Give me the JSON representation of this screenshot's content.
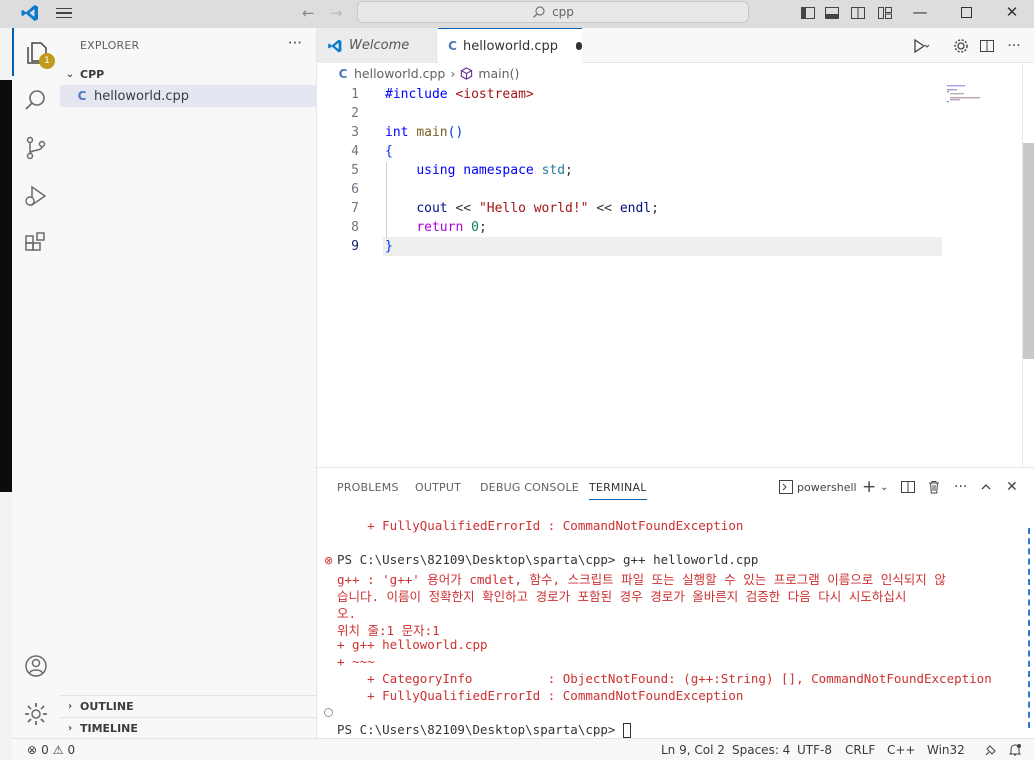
{
  "titlebar": {
    "search_text": "cpp",
    "back_arrow": "←",
    "forward_arrow": "→"
  },
  "activity": {
    "explorer_badge": "1"
  },
  "sidebar": {
    "title": "EXPLORER",
    "more": "···",
    "folder": "CPP",
    "file": "helloworld.cpp",
    "outline": "OUTLINE",
    "timeline": "TIMELINE"
  },
  "tabs": {
    "welcome": "Welcome",
    "active": "helloworld.cpp"
  },
  "breadcrumb": {
    "file": "helloworld.cpp",
    "symbol": "main()"
  },
  "code": {
    "line_numbers": [
      "1",
      "2",
      "3",
      "4",
      "5",
      "6",
      "7",
      "8",
      "9"
    ]
  },
  "panel": {
    "tabs": [
      "PROBLEMS",
      "OUTPUT",
      "DEBUG CONSOLE",
      "TERMINAL"
    ],
    "shell": "powershell",
    "terminal_lines": [
      "    + FullyQualifiedErrorId : CommandNotFoundException",
      "PS C:\\Users\\82109\\Desktop\\sparta\\cpp> g++ helloworld.cpp",
      "g++ : 'g++' 용어가 cmdlet, 함수, 스크립트 파일 또는 실행할 수 있는 프로그램 이름으로 인식되지 않",
      "습니다. 이름이 정확한지 확인하고 경로가 포함된 경우 경로가 올바른지 검증한 다음 다시 시도하십시",
      "오.",
      "위치 줄:1 문자:1",
      "+ g++ helloworld.cpp",
      "+ ~~~",
      "    + CategoryInfo          : ObjectNotFound: (g++:String) [], CommandNotFoundException",
      "    + FullyQualifiedErrorId : CommandNotFoundException",
      "PS C:\\Users\\82109\\Desktop\\sparta\\cpp> "
    ]
  },
  "status": {
    "errors": "0",
    "warnings": "0",
    "position": "Ln 9, Col 2",
    "spaces": "Spaces: 4",
    "encoding": "UTF-8",
    "eol": "CRLF",
    "language": "C++",
    "platform": "Win32"
  },
  "colors": {
    "accent": "#005fb8",
    "error": "#cd3131",
    "badge": "#c29a1c"
  }
}
